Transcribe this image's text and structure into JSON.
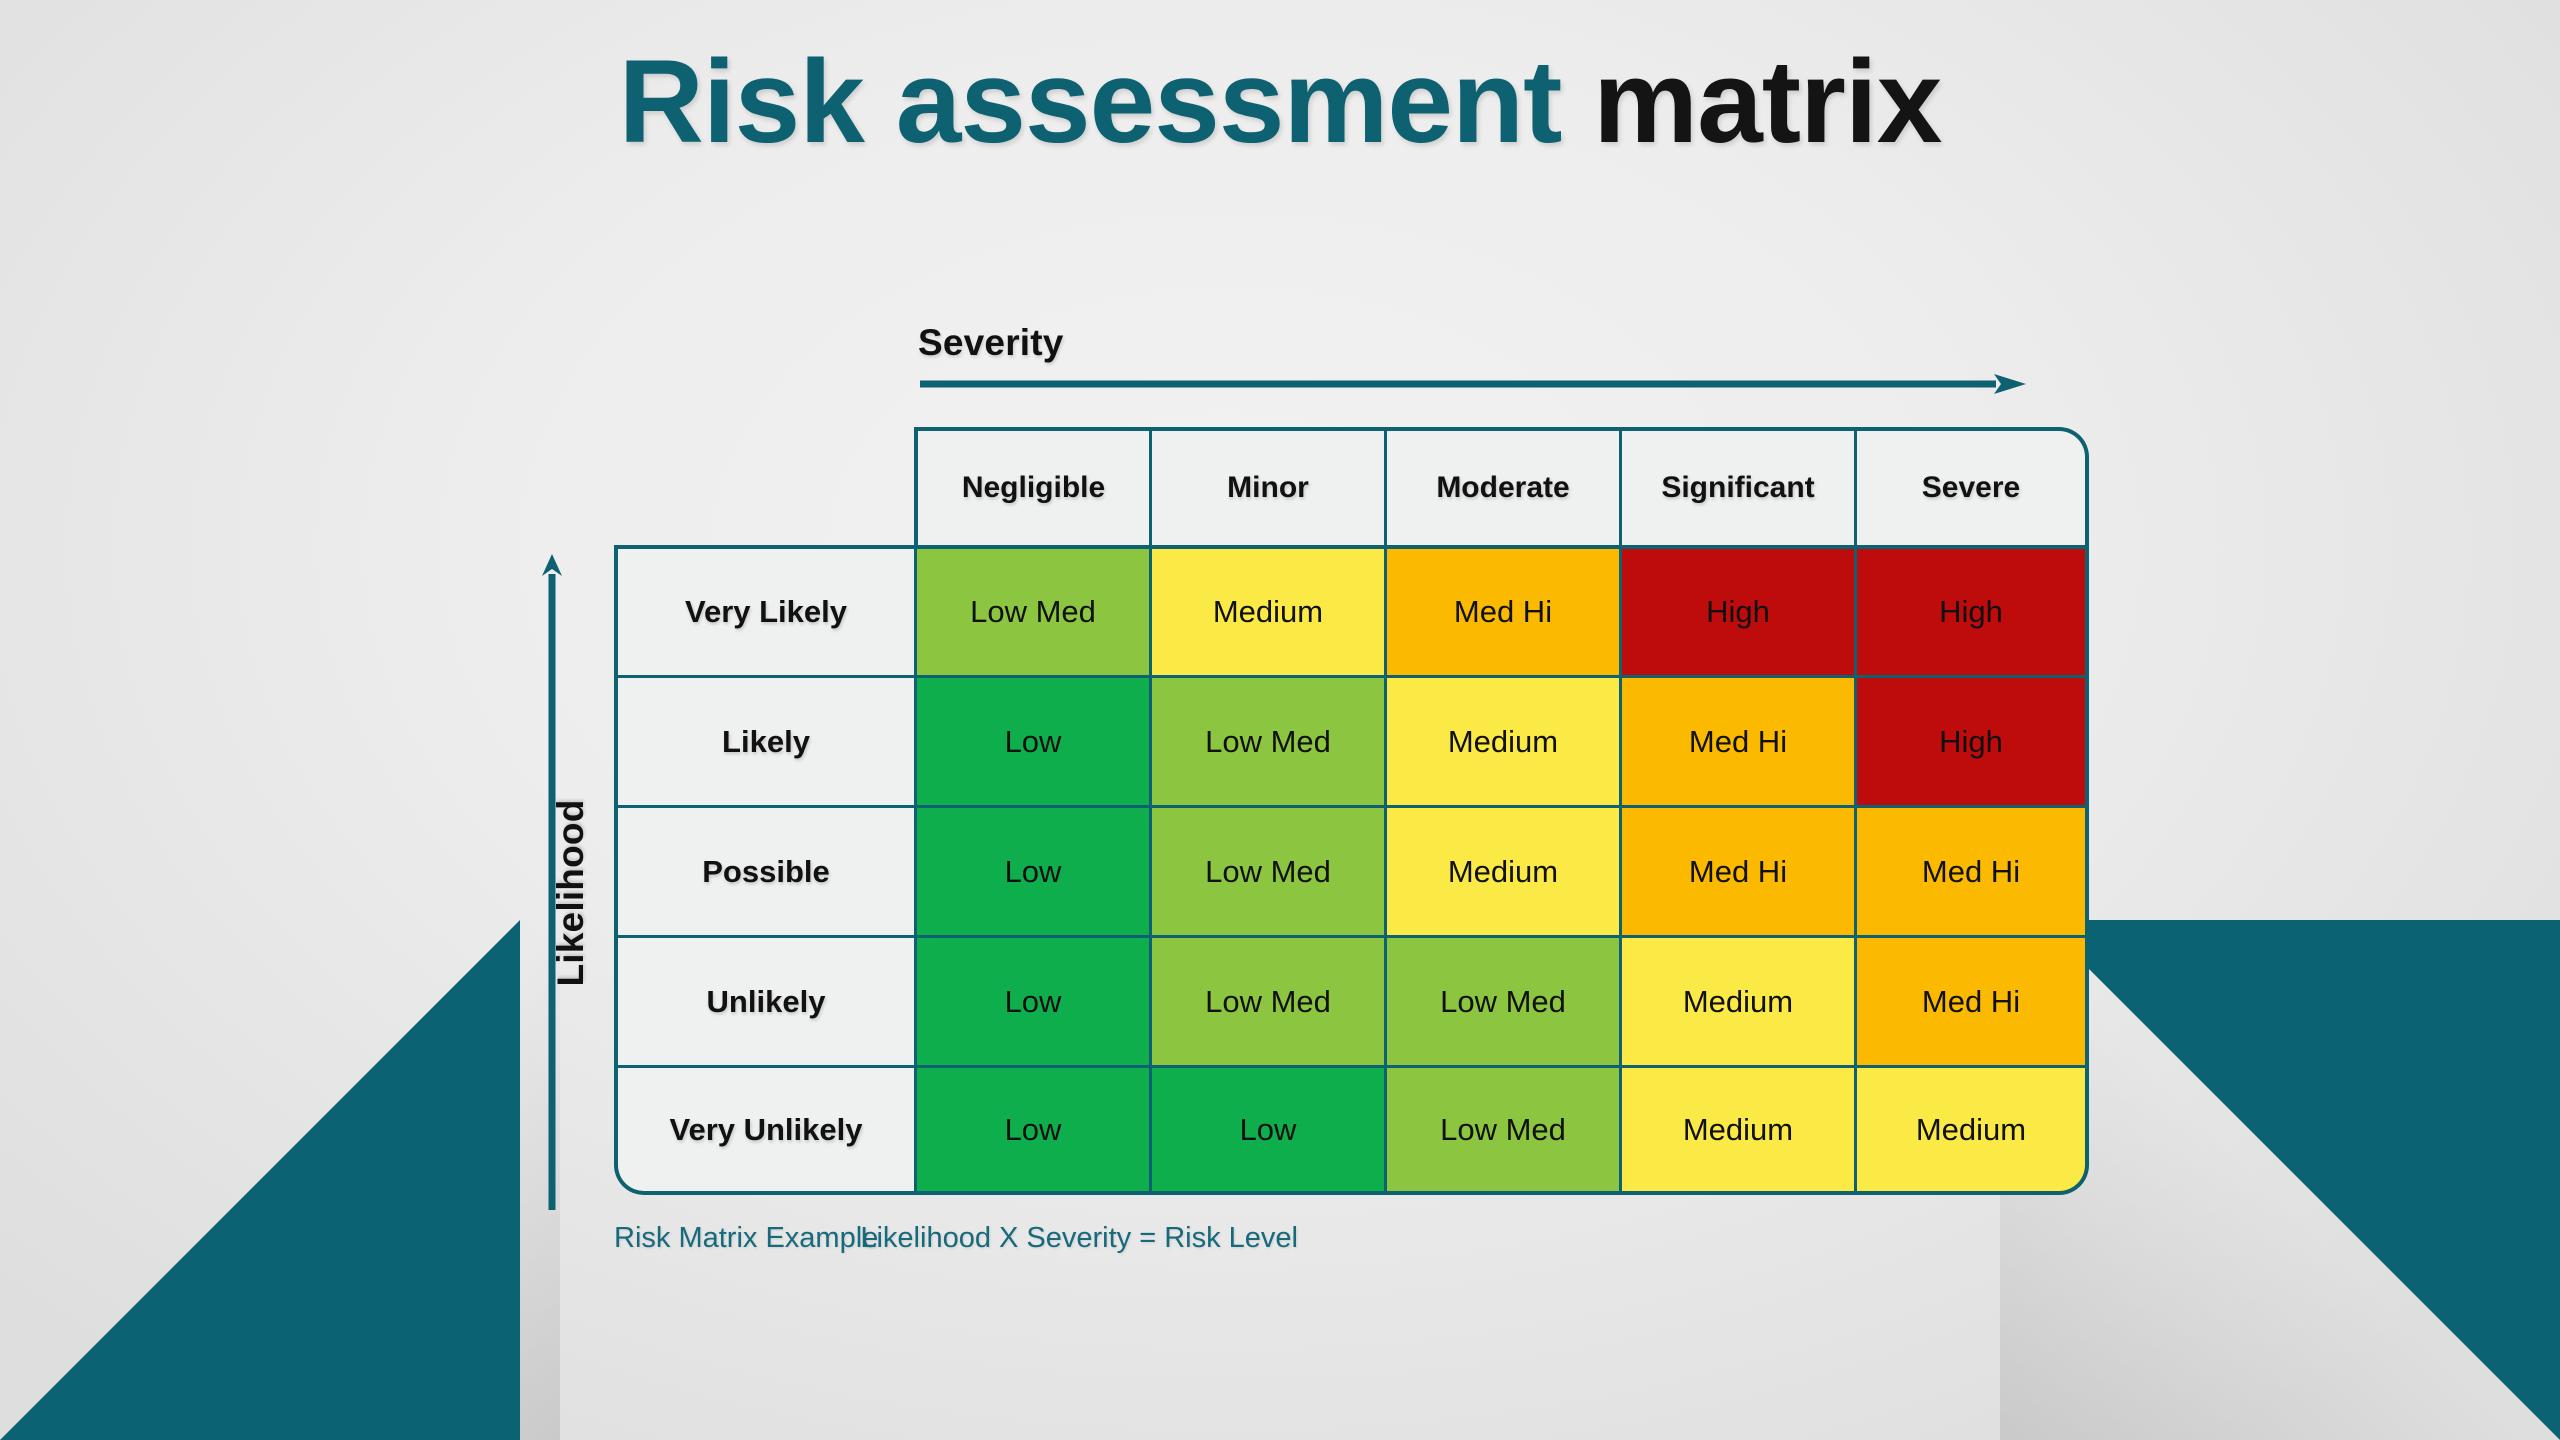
{
  "title": {
    "accent_text": "Risk assessment",
    "plain_text": " matrix"
  },
  "axes": {
    "x_label": "Severity",
    "y_label": "Likelihood",
    "x_arrow_icon": "arrow-right-icon",
    "y_arrow_icon": "arrow-up-icon"
  },
  "captions": {
    "left": "Risk Matrix Example",
    "right": "Likelihood X Severity = Risk Level"
  },
  "colors": {
    "accent_teal": "#0d6171",
    "corner_teal": "#0b6272",
    "header_bg": "#eff0f0",
    "low": "#0fae4d",
    "low_med": "#8cc641",
    "medium": "#fbe945",
    "med_hi": "#fbba00",
    "high": "#be0b0b",
    "background": "#ededed"
  },
  "chart_data": {
    "type": "heatmap",
    "title": "Risk assessment matrix",
    "xlabel": "Severity",
    "ylabel": "Likelihood",
    "legend": null,
    "grid": true,
    "x_categories": [
      "Negligible",
      "Minor",
      "Moderate",
      "Significant",
      "Severe"
    ],
    "y_categories": [
      "Very Likely",
      "Likely",
      "Possible",
      "Unlikely",
      "Very Unlikely"
    ],
    "corner_blank_label": "",
    "level_colors": {
      "Low": "#0fae4d",
      "Low Med": "#8cc641",
      "Medium": "#fbe945",
      "Med Hi": "#fbba00",
      "High": "#be0b0b"
    },
    "rows": [
      {
        "likelihood": "Very Likely",
        "cells": [
          {
            "severity": "Negligible",
            "level": "Low Med",
            "color": "#8cc641"
          },
          {
            "severity": "Minor",
            "level": "Medium",
            "color": "#fbe945"
          },
          {
            "severity": "Moderate",
            "level": "Med Hi",
            "color": "#fbba00"
          },
          {
            "severity": "Significant",
            "level": "High",
            "color": "#be0b0b"
          },
          {
            "severity": "Severe",
            "level": "High",
            "color": "#be0b0b"
          }
        ]
      },
      {
        "likelihood": "Likely",
        "cells": [
          {
            "severity": "Negligible",
            "level": "Low",
            "color": "#0fae4d"
          },
          {
            "severity": "Minor",
            "level": "Low Med",
            "color": "#8cc641"
          },
          {
            "severity": "Moderate",
            "level": "Medium",
            "color": "#fbe945"
          },
          {
            "severity": "Significant",
            "level": "Med Hi",
            "color": "#fbba00"
          },
          {
            "severity": "Severe",
            "level": "High",
            "color": "#be0b0b"
          }
        ]
      },
      {
        "likelihood": "Possible",
        "cells": [
          {
            "severity": "Negligible",
            "level": "Low",
            "color": "#0fae4d"
          },
          {
            "severity": "Minor",
            "level": "Low Med",
            "color": "#8cc641"
          },
          {
            "severity": "Moderate",
            "level": "Medium",
            "color": "#fbe945"
          },
          {
            "severity": "Significant",
            "level": "Med Hi",
            "color": "#fbba00"
          },
          {
            "severity": "Severe",
            "level": "Med Hi",
            "color": "#fbba00"
          }
        ]
      },
      {
        "likelihood": "Unlikely",
        "cells": [
          {
            "severity": "Negligible",
            "level": "Low",
            "color": "#0fae4d"
          },
          {
            "severity": "Minor",
            "level": "Low Med",
            "color": "#8cc641"
          },
          {
            "severity": "Moderate",
            "level": "Low Med",
            "color": "#8cc641"
          },
          {
            "severity": "Significant",
            "level": "Medium",
            "color": "#fbe945"
          },
          {
            "severity": "Severe",
            "level": "Med Hi",
            "color": "#fbba00"
          }
        ]
      },
      {
        "likelihood": "Very Unlikely",
        "cells": [
          {
            "severity": "Negligible",
            "level": "Low",
            "color": "#0fae4d"
          },
          {
            "severity": "Minor",
            "level": "Low",
            "color": "#0fae4d"
          },
          {
            "severity": "Moderate",
            "level": "Low Med",
            "color": "#8cc641"
          },
          {
            "severity": "Significant",
            "level": "Medium",
            "color": "#fbe945"
          },
          {
            "severity": "Severe",
            "level": "Medium",
            "color": "#fbe945"
          }
        ]
      }
    ]
  }
}
